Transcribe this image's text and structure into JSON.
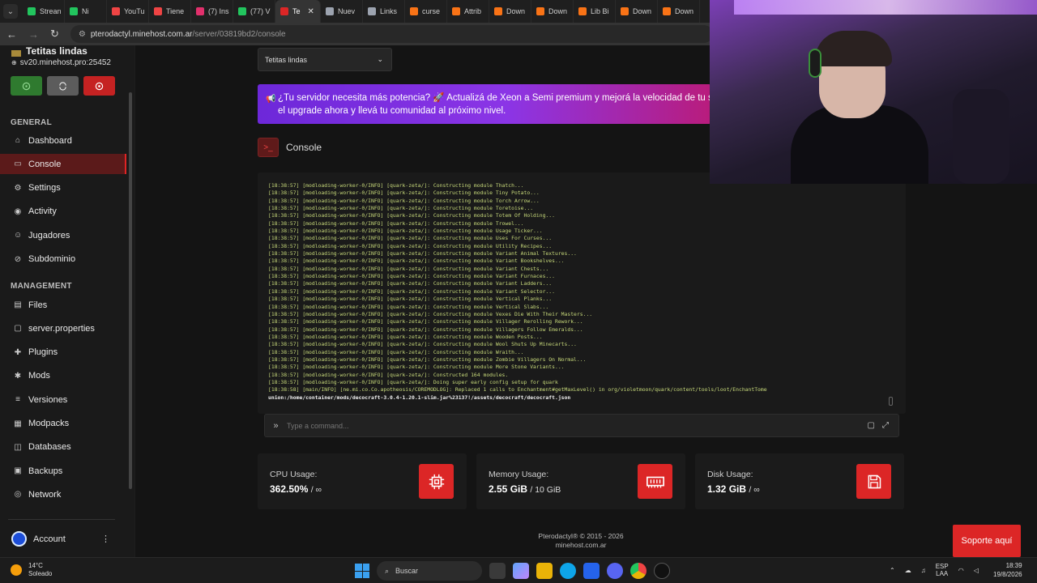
{
  "browser": {
    "tabs": [
      {
        "label": "Strean",
        "color": "#22c55e"
      },
      {
        "label": "Ni",
        "color": "#22c55e"
      },
      {
        "label": "YouTu",
        "color": "#ef4444"
      },
      {
        "label": "Tiene",
        "color": "#ef4444"
      },
      {
        "label": "(7) Ins",
        "color": "#e1306c"
      },
      {
        "label": "(77) V",
        "color": "#22c55e"
      },
      {
        "label": "Te",
        "color": "#dc2626"
      },
      {
        "label": "Nuev",
        "color": "#9ca3af"
      },
      {
        "label": "Links",
        "color": "#9ca3af"
      },
      {
        "label": "curse",
        "color": "#f97316"
      },
      {
        "label": "Attrib",
        "color": "#f97316"
      },
      {
        "label": "Down",
        "color": "#f97316"
      },
      {
        "label": "Down",
        "color": "#f97316"
      },
      {
        "label": "Lib Bi",
        "color": "#f97316"
      },
      {
        "label": "Down",
        "color": "#f97316"
      },
      {
        "label": "Down",
        "color": "#f97316"
      }
    ],
    "url_host": "pterodactyl.minehost.com.ar",
    "url_path": "/server/03819bd2/console"
  },
  "sidebar": {
    "server_name": "Tetitas lindas",
    "server_address": "sv20.minehost.pro:25452",
    "section_general": "GENERAL",
    "section_management": "MANAGEMENT",
    "general_items": [
      {
        "label": "Dashboard",
        "icon": "home-icon"
      },
      {
        "label": "Console",
        "icon": "terminal-icon"
      },
      {
        "label": "Settings",
        "icon": "gear-icon"
      },
      {
        "label": "Activity",
        "icon": "eye-icon"
      },
      {
        "label": "Jugadores",
        "icon": "users-icon"
      },
      {
        "label": "Subdominio",
        "icon": "link-icon"
      }
    ],
    "management_items": [
      {
        "label": "Files",
        "icon": "folder-icon"
      },
      {
        "label": "server.properties",
        "icon": "file-icon"
      },
      {
        "label": "Plugins",
        "icon": "puzzle-icon"
      },
      {
        "label": "Mods",
        "icon": "bug-icon"
      },
      {
        "label": "Versiones",
        "icon": "layers-icon"
      },
      {
        "label": "Modpacks",
        "icon": "box-icon"
      },
      {
        "label": "Databases",
        "icon": "database-icon"
      },
      {
        "label": "Backups",
        "icon": "archive-icon"
      },
      {
        "label": "Network",
        "icon": "globe-icon"
      }
    ],
    "account_label": "Account"
  },
  "main": {
    "server_select": "Tetitas lindas",
    "banner_line1": "¿Tu servidor necesita más potencia? 🚀 Actualizá de Xeon a Semi premium y mejorá la velocidad de tu serv",
    "banner_line2": "el upgrade ahora y llevá tu comunidad al próximo nivel.",
    "console_title": "Console",
    "console_lines": [
      "[18:38:57] [modloading-worker-0/INFO] [quark-zeta/]: Constructing module Thatch...",
      "[18:38:57] [modloading-worker-0/INFO] [quark-zeta/]: Constructing module Tiny Potato...",
      "[18:38:57] [modloading-worker-0/INFO] [quark-zeta/]: Constructing module Torch Arrow...",
      "[18:38:57] [modloading-worker-0/INFO] [quark-zeta/]: Constructing module Toretoise...",
      "[18:38:57] [modloading-worker-0/INFO] [quark-zeta/]: Constructing module Totem Of Holding...",
      "[18:38:57] [modloading-worker-0/INFO] [quark-zeta/]: Constructing module Trowel...",
      "[18:38:57] [modloading-worker-0/INFO] [quark-zeta/]: Constructing module Usage Ticker...",
      "[18:38:57] [modloading-worker-0/INFO] [quark-zeta/]: Constructing module Uses For Curses...",
      "[18:38:57] [modloading-worker-0/INFO] [quark-zeta/]: Constructing module Utility Recipes...",
      "[18:38:57] [modloading-worker-0/INFO] [quark-zeta/]: Constructing module Variant Animal Textures...",
      "[18:38:57] [modloading-worker-0/INFO] [quark-zeta/]: Constructing module Variant Bookshelves...",
      "[18:38:57] [modloading-worker-0/INFO] [quark-zeta/]: Constructing module Variant Chests...",
      "[18:38:57] [modloading-worker-0/INFO] [quark-zeta/]: Constructing module Variant Furnaces...",
      "[18:38:57] [modloading-worker-0/INFO] [quark-zeta/]: Constructing module Variant Ladders...",
      "[18:38:57] [modloading-worker-0/INFO] [quark-zeta/]: Constructing module Variant Selector...",
      "[18:38:57] [modloading-worker-0/INFO] [quark-zeta/]: Constructing module Vertical Planks...",
      "[18:38:57] [modloading-worker-0/INFO] [quark-zeta/]: Constructing module Vertical Slabs...",
      "[18:38:57] [modloading-worker-0/INFO] [quark-zeta/]: Constructing module Vexes Die With Their Masters...",
      "[18:38:57] [modloading-worker-0/INFO] [quark-zeta/]: Constructing module Villager Rerolling Rework...",
      "[18:38:57] [modloading-worker-0/INFO] [quark-zeta/]: Constructing module Villagers Follow Emeralds...",
      "[18:38:57] [modloading-worker-0/INFO] [quark-zeta/]: Constructing module Wooden Posts...",
      "[18:38:57] [modloading-worker-0/INFO] [quark-zeta/]: Constructing module Wool Shuts Up Minecarts...",
      "[18:38:57] [modloading-worker-0/INFO] [quark-zeta/]: Constructing module Wraith...",
      "[18:38:57] [modloading-worker-0/INFO] [quark-zeta/]: Constructing module Zombie Villagers On Normal...",
      "[18:38:57] [modloading-worker-0/INFO] [quark-zeta/]: Constructing module More Stone Variants...",
      "[18:38:57] [modloading-worker-0/INFO] [quark-zeta/]: Constructed 164 modules.",
      "[18:38:57] [modloading-worker-0/INFO] [quark-zeta/]: Doing super early config setup for quark",
      "[18:38:58] [main/INFO] [ne.mi.co.Co.apotheosis/COREMODLOG]: Replaced 1 calls to Enchantment#getMaxLevel() in org/violetmoon/quark/content/tools/loot/EnchantTome"
    ],
    "console_last_line": "union:/home/container/mods/decocraft-3.0.4-1.20.1-slim.jar%23137!/assets/decocraft/decocraft.json",
    "command_placeholder": "Type a command...",
    "stats": [
      {
        "label": "CPU Usage:",
        "value": "362.50%",
        "limit": "/ ∞",
        "icon": "cpu-icon"
      },
      {
        "label": "Memory Usage:",
        "value": "2.55 GiB",
        "limit": "/ 10 GiB",
        "icon": "memory-icon"
      },
      {
        "label": "Disk Usage:",
        "value": "1.32 GiB",
        "limit": "/ ∞",
        "icon": "save-icon"
      }
    ],
    "footer_line1": "Pterodactyl® © 2015 - 2026",
    "footer_line2": "minehost.com.ar",
    "support_label": "Soporte aquí"
  },
  "taskbar": {
    "temperature": "14°C",
    "weather": "Soleado",
    "search_placeholder": "Buscar",
    "lang1": "ESP",
    "lang2": "LAA",
    "time": "18:39",
    "date": "19/8/2026"
  }
}
